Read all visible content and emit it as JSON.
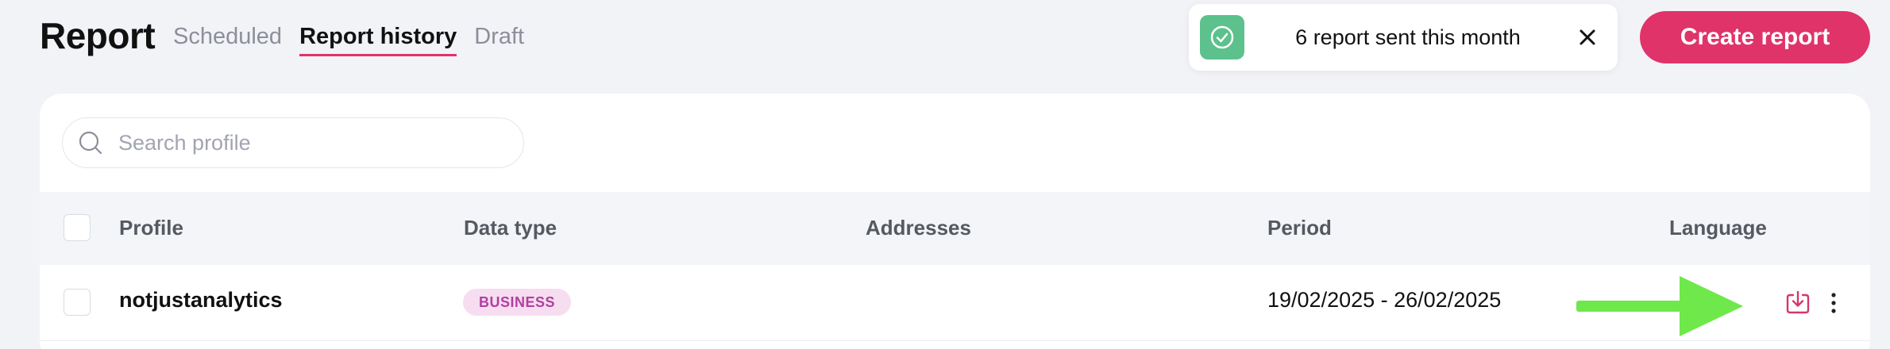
{
  "header": {
    "title": "Report",
    "tabs": [
      {
        "label": "Scheduled",
        "active": false
      },
      {
        "label": "Report history",
        "active": true
      },
      {
        "label": "Draft",
        "active": false
      }
    ]
  },
  "toast": {
    "message": "6 report sent this month",
    "icon": "check-circle-icon",
    "close_icon": "close-icon",
    "accent": "#5cc18c"
  },
  "create_button": {
    "label": "Create report",
    "color": "#e0336a"
  },
  "search": {
    "placeholder": "Search profile",
    "value": ""
  },
  "table": {
    "columns": [
      "Profile",
      "Data type",
      "Addresses",
      "Period",
      "Language"
    ],
    "rows": [
      {
        "profile": "notjustanalytics",
        "data_type": "BUSINESS",
        "addresses": "",
        "period": "19/02/2025 - 26/02/2025",
        "language": "",
        "actions": [
          "download-icon",
          "more-vertical-icon"
        ]
      }
    ]
  },
  "colors": {
    "accent": "#e0336a",
    "success": "#5cc18c",
    "annotation_arrow": "#6ee84a",
    "badge_bg": "#f6ddf0",
    "badge_text": "#b23fa0"
  }
}
